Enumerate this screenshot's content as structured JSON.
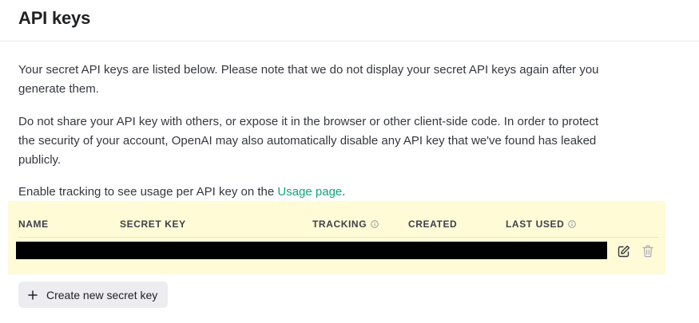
{
  "header": {
    "title": "API keys"
  },
  "intro": {
    "paragraph1": "Your secret API keys are listed below. Please note that we do not display your secret API keys again after you generate them.",
    "paragraph2": "Do not share your API key with others, or expose it in the browser or other client-side code. In order to protect the security of your account, OpenAI may also automatically disable any API key that we've found has leaked publicly.",
    "tracking_prefix": "Enable tracking to see usage per API key on the ",
    "usage_link": "Usage page",
    "tracking_suffix": "."
  },
  "table": {
    "columns": {
      "name": "NAME",
      "secret_key": "SECRET KEY",
      "tracking": "TRACKING",
      "created": "CREATED",
      "last_used": "LAST USED"
    },
    "rows": [
      {
        "redacted": true
      }
    ]
  },
  "actions": {
    "create_label": "Create new secret key"
  },
  "icons": {
    "tracking_info": "info-icon",
    "last_used_info": "info-icon",
    "edit": "pencil-square-icon",
    "delete": "trash-icon",
    "create": "plus-icon"
  },
  "colors": {
    "link": "#10a37f",
    "highlight": "#fefbd6",
    "button_bg": "#ececf1",
    "text": "#353740"
  }
}
